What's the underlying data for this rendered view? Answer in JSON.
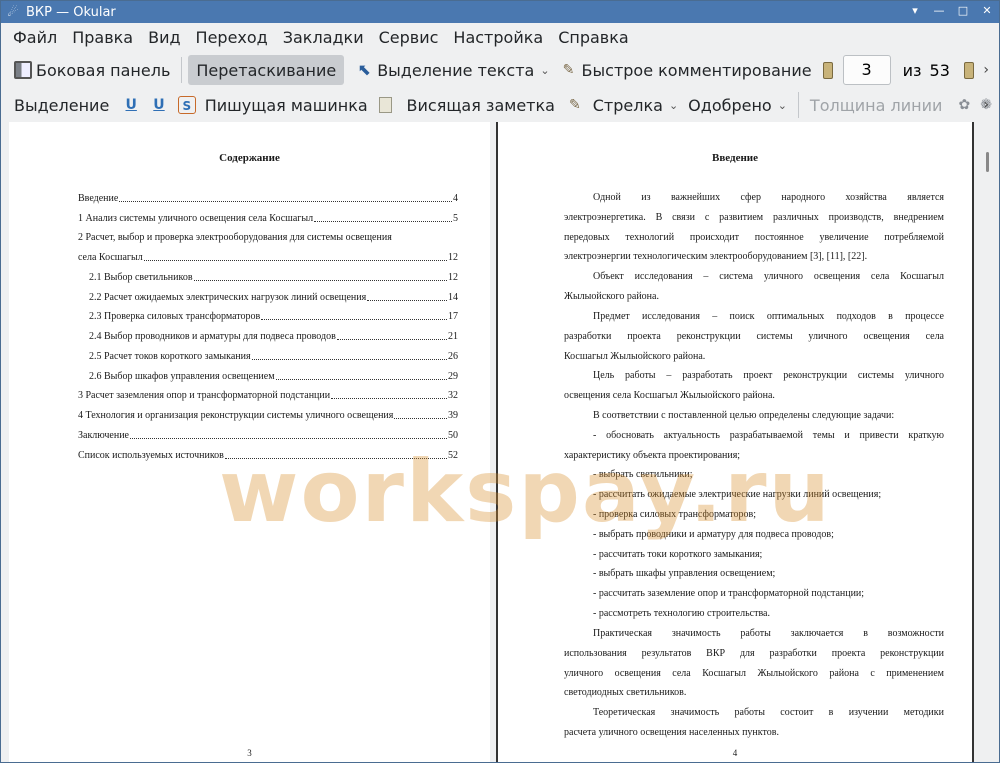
{
  "window": {
    "title": "ВКР  — Okular"
  },
  "menu": [
    "Файл",
    "Правка",
    "Вид",
    "Переход",
    "Закладки",
    "Сервис",
    "Настройка",
    "Справка"
  ],
  "toolbar1": {
    "sidebar": "Боковая панель",
    "drag": "Перетаскивание",
    "text_select": "Выделение текста",
    "quick_comment": "Быстрое комментирование",
    "page_current": "3",
    "of": "из",
    "page_total": "53"
  },
  "toolbar2": {
    "highlight": "Выделение",
    "typewriter": "Пишущая машинка",
    "pinned_note": "Висящая заметка",
    "arrow": "Стрелка",
    "approved": "Одобрено",
    "line_width": "Толщина линии"
  },
  "left_page": {
    "title": "Содержание",
    "toc": [
      {
        "text": "Введение",
        "page": "4"
      },
      {
        "text": "1 Анализ системы уличного освещения села Косшагыл",
        "page": "5"
      },
      {
        "text": "2 Расчет, выбор и проверка электрооборудования для системы освещения",
        "page": ""
      },
      {
        "text": "села Косшагыл",
        "page": "12"
      },
      {
        "text": "2.1 Выбор светильников",
        "page": "12"
      },
      {
        "text": "2.2 Расчет ожидаемых электрических нагрузок линий освещения",
        "page": "14"
      },
      {
        "text": "2.3 Проверка силовых трансформаторов",
        "page": "17"
      },
      {
        "text": "2.4 Выбор проводников и арматуры для подвеса проводов",
        "page": "21"
      },
      {
        "text": "2.5 Расчет токов короткого замыкания",
        "page": "26"
      },
      {
        "text": "2.6 Выбор шкафов управления освещением",
        "page": "29"
      },
      {
        "text": "3 Расчет заземления опор и трансформаторной подстанции",
        "page": "32"
      },
      {
        "text": "4 Технология и организация реконструкции системы уличного освещения",
        "page": "39"
      },
      {
        "text": "Заключение",
        "page": "50"
      },
      {
        "text": "Список используемых источников",
        "page": "52"
      }
    ],
    "page_number": "3"
  },
  "right_page": {
    "title": "Введение",
    "lines": [
      "Одной из важнейших сфер народного хозяйства является",
      "электроэнергетика. В связи с развитием различных производств, внедрением",
      "передовых технологий происходит постоянное увеличение потребляемой",
      "электроэнергии технологическим электрооборудованием [3], [11], [22].",
      "Объект исследования – система уличного освещения села Косшагыл",
      "Жылыойского района.",
      "Предмет исследования – поиск оптимальных подходов в процессе",
      "разработки проекта реконструкции системы уличного освещения села",
      "Косшагыл Жылыойского района.",
      "Цель работы – разработать проект реконструкции системы уличного",
      "освещения села Косшагыл Жылыойского района.",
      "В соответствии с поставленной целью определены следующие задачи:",
      "- обосновать актуальность разрабатываемой темы и привести краткую",
      "характеристику объекта проектирования;",
      "- выбрать светильники;",
      "- рассчитать ожидаемые электрические нагрузки линий освещения;",
      "- проверка силовых трансформаторов;",
      "- выбрать проводники и арматуру для подвеса проводов;",
      "- рассчитать токи короткого замыкания;",
      "- выбрать шкафы управления освещением;",
      "- рассчитать заземление опор и трансформаторной подстанции;",
      "- рассмотреть технологию строительства.",
      "Практическая значимость работы заключается в возможности",
      "использования результатов ВКР для разработки проекта реконструкции",
      "уличного освещения села Косшагыл Жылыойского района с применением",
      "светодиодных светильников.",
      "Теоретическая значимость работы состоит в изучении методики",
      "расчета уличного освещения населенных пунктов."
    ],
    "page_number": "4"
  },
  "watermark": "workspay.ru"
}
